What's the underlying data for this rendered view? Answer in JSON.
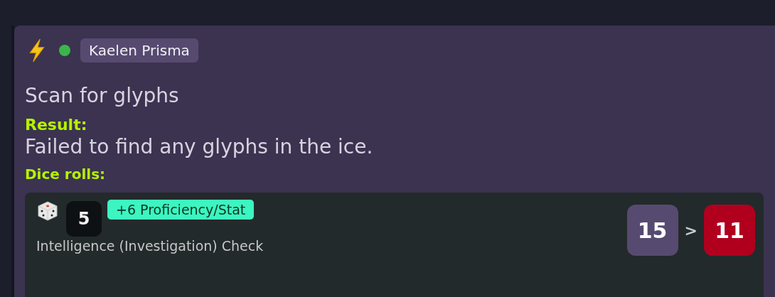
{
  "entry": {
    "online": true,
    "author": "Kaelen Prisma",
    "action": "Scan for glyphs",
    "result_label": "Result:",
    "result": "Failed to find any glyphs in the ice.",
    "dice_label": "Dice rolls:"
  },
  "rolls": [
    {
      "die": "5",
      "modifier": "+6 Proficiency/Stat",
      "check": "Intelligence (Investigation) Check",
      "dc": "15",
      "comparator": ">",
      "total": "11",
      "success": false
    }
  ]
}
